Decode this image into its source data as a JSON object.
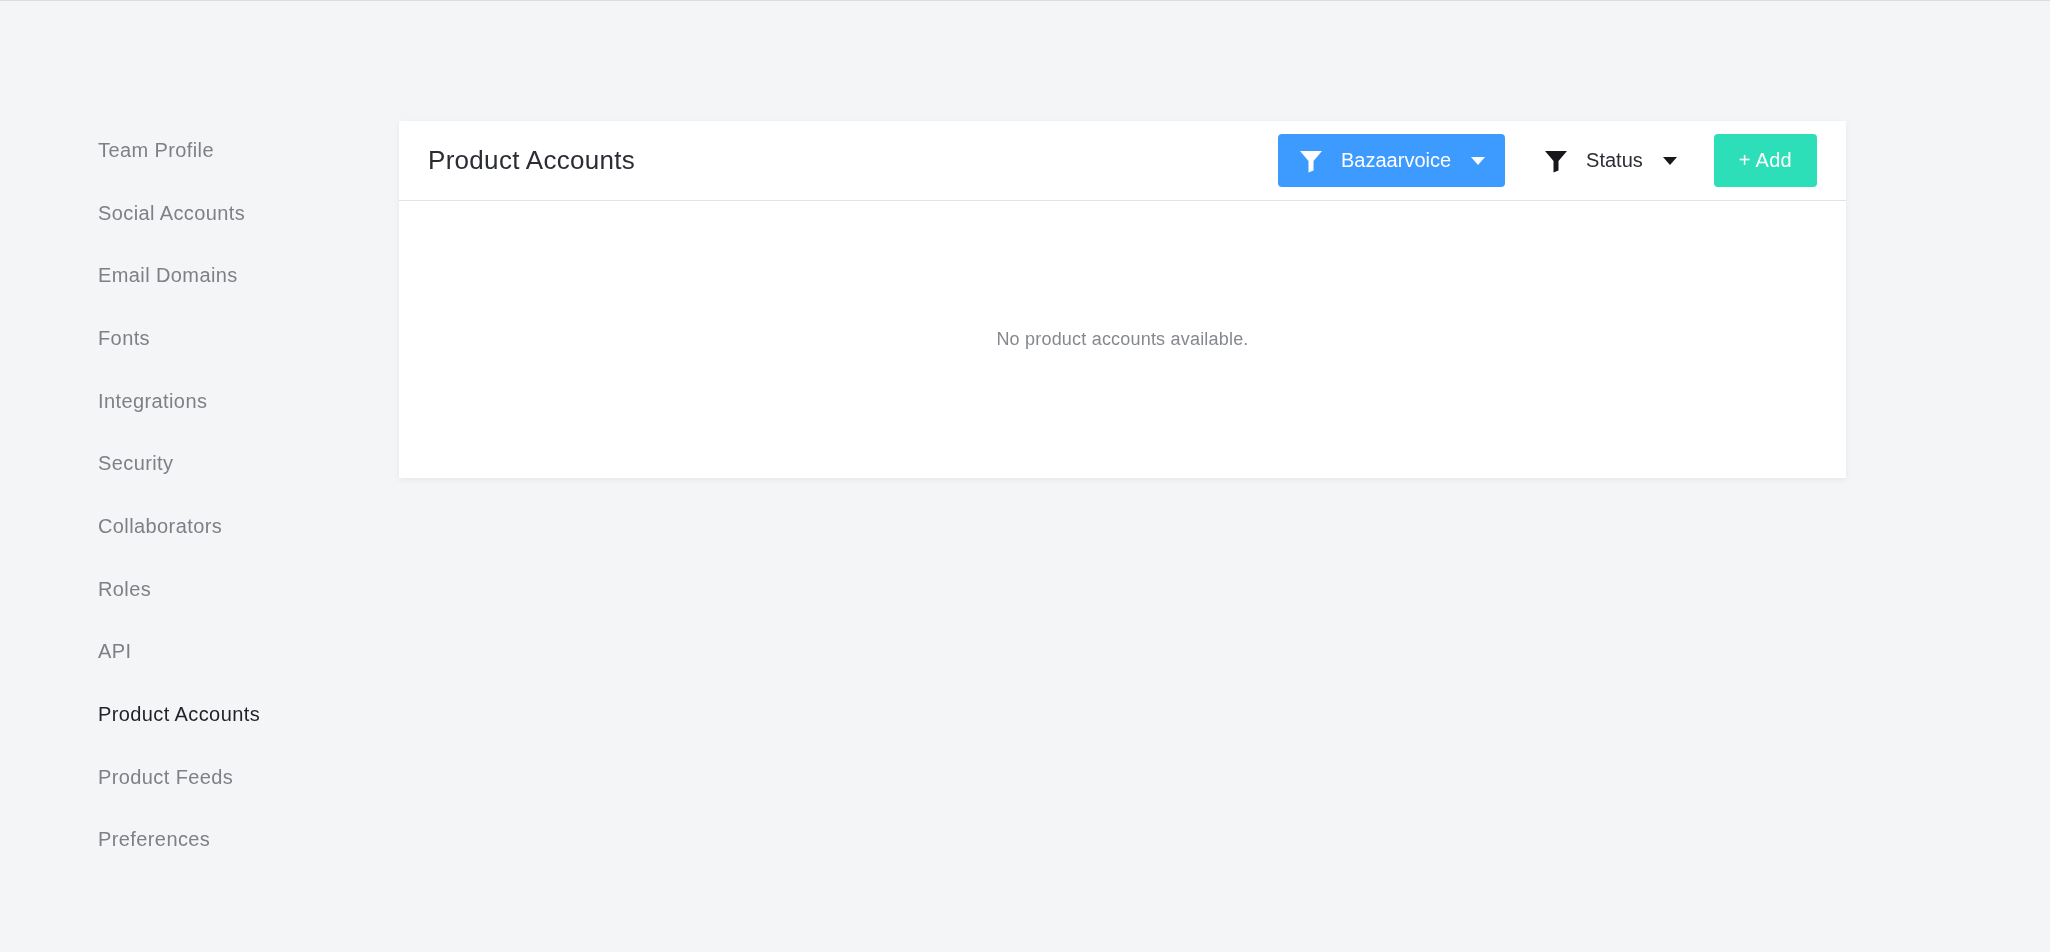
{
  "sidebar": {
    "items": [
      {
        "label": "Team Profile",
        "selected": false
      },
      {
        "label": "Social Accounts",
        "selected": false
      },
      {
        "label": "Email Domains",
        "selected": false
      },
      {
        "label": "Fonts",
        "selected": false
      },
      {
        "label": "Integrations",
        "selected": false
      },
      {
        "label": "Security",
        "selected": false
      },
      {
        "label": "Collaborators",
        "selected": false
      },
      {
        "label": "Roles",
        "selected": false
      },
      {
        "label": "API",
        "selected": false
      },
      {
        "label": "Product Accounts",
        "selected": true
      },
      {
        "label": "Product Feeds",
        "selected": false
      },
      {
        "label": "Preferences",
        "selected": false
      }
    ]
  },
  "panel": {
    "title": "Product Accounts",
    "filters": [
      {
        "label": "Bazaarvoice",
        "active": true
      },
      {
        "label": "Status",
        "active": false
      }
    ],
    "add_button": "+ Add",
    "empty_message": "No product accounts available."
  }
}
